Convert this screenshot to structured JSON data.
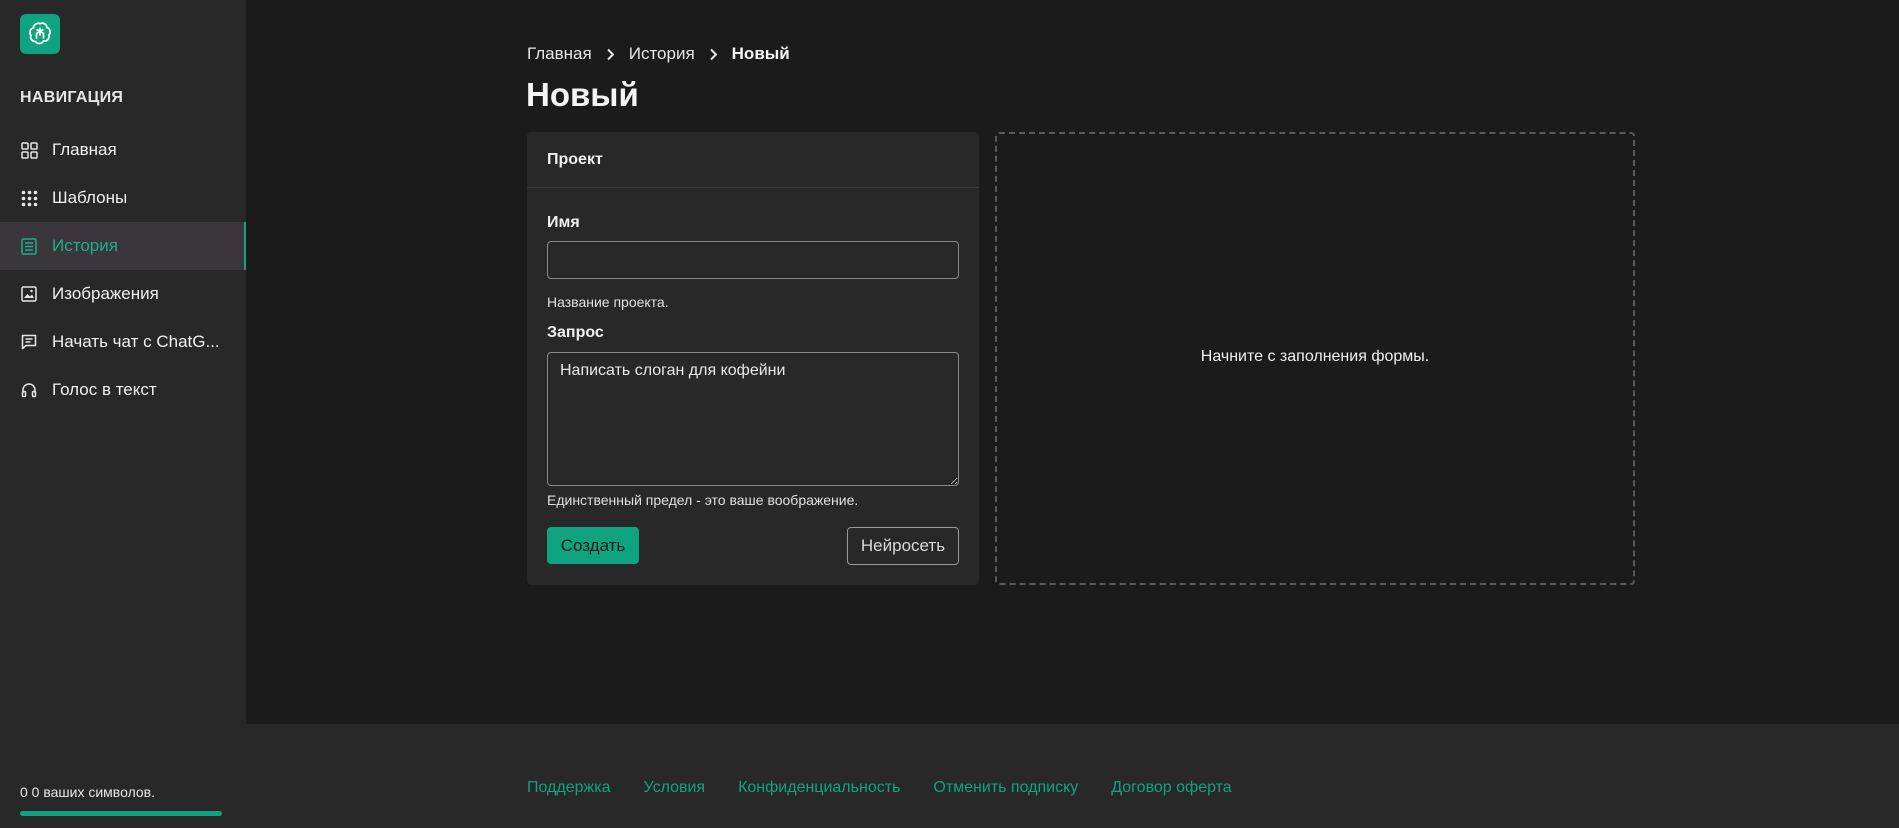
{
  "sidebar": {
    "nav_heading": "НАВИГАЦИЯ",
    "items": [
      {
        "label": "Главная",
        "icon": "grid-icon"
      },
      {
        "label": "Шаблоны",
        "icon": "dots-grid-icon"
      },
      {
        "label": "История",
        "icon": "document-list-icon",
        "active": true
      },
      {
        "label": "Изображения",
        "icon": "image-icon"
      },
      {
        "label": "Начать чат с ChatG...",
        "icon": "chat-icon"
      },
      {
        "label": "Голос в текст",
        "icon": "headphones-icon"
      }
    ],
    "credits_text": "0 0 ваших символов.",
    "credits_progress": 1.0
  },
  "breadcrumb": {
    "items": [
      "Главная",
      "История",
      "Новый"
    ]
  },
  "page": {
    "title": "Новый"
  },
  "form": {
    "header": "Проект",
    "name_label": "Имя",
    "name_value": "",
    "name_hint": "Название проекта.",
    "prompt_label": "Запрос",
    "prompt_value": "Написать слоган для кофейни",
    "prompt_hint": "Единственный предел - это ваше воображение.",
    "create_label": "Создать",
    "model_label": "Нейросеть"
  },
  "result": {
    "placeholder": "Начните с заполнения формы."
  },
  "footer": {
    "links": [
      "Поддержка",
      "Условия",
      "Конфиденциальность",
      "Отменить подписку",
      "Договор оферта"
    ]
  },
  "colors": {
    "accent": "#10a37f",
    "background": "#1b1b1b",
    "panel": "#282828"
  }
}
